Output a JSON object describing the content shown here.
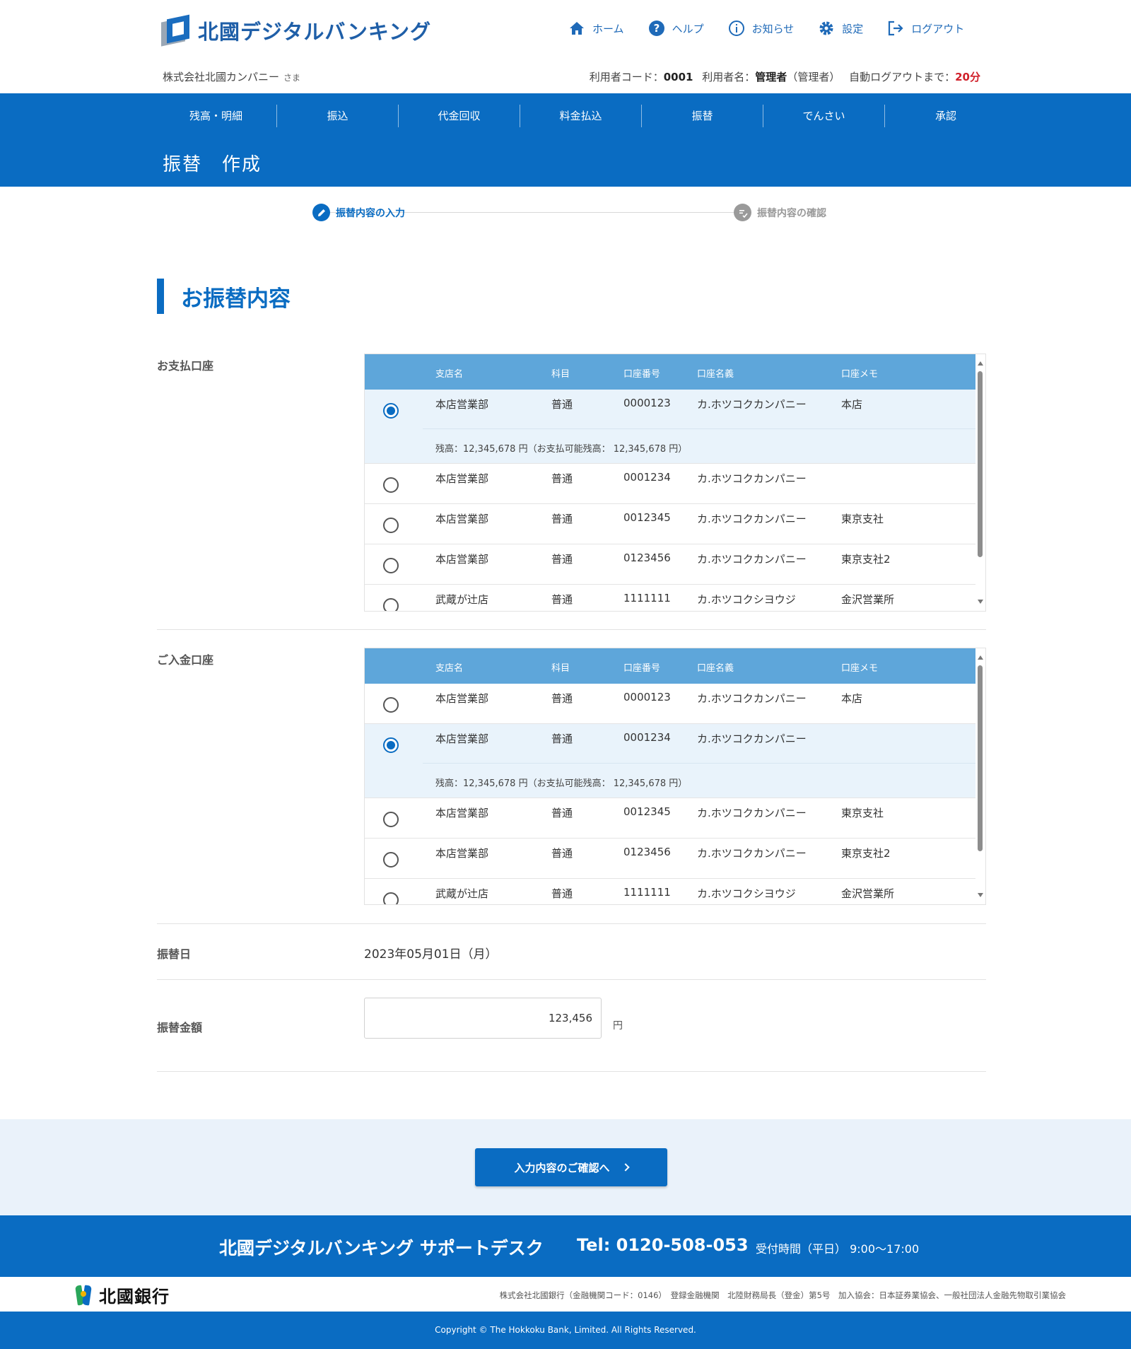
{
  "header": {
    "brand": "北國デジタルバンキング",
    "nav": [
      {
        "label": "ホーム",
        "icon": "home-icon"
      },
      {
        "label": "ヘルプ",
        "icon": "help-icon"
      },
      {
        "label": "お知らせ",
        "icon": "info-icon"
      },
      {
        "label": "設定",
        "icon": "gear-icon"
      },
      {
        "label": "ログアウト",
        "icon": "logout-icon"
      }
    ],
    "company": "株式会社北國カンパニー",
    "honorific": "さま",
    "user_code_label": "利用者コード：",
    "user_code": "0001",
    "user_name_label": "利用者名：",
    "user_name": "管理者",
    "user_role": "（管理者）",
    "auto_logout_label": "自動ログアウトまで：",
    "auto_logout": "20分"
  },
  "global_nav": [
    "残高・明細",
    "振込",
    "代金回収",
    "料金払込",
    "振替",
    "でんさい",
    "承認"
  ],
  "page_title": "振替　作成",
  "stepper": {
    "step1": "振替内容の入力",
    "step2": "振替内容の確認"
  },
  "section_title": "お振替内容",
  "columns": [
    "支店名",
    "科目",
    "口座番号",
    "口座名義",
    "口座メモ"
  ],
  "payment": {
    "label": "お支払口座",
    "rows": [
      {
        "branch": "本店営業部",
        "type": "普通",
        "number": "0000123",
        "holder": "カ.ホツコクカンパニー",
        "memo": "本店",
        "selected": true,
        "balance": "残高：12,345,678 円（お支払可能残高： 12,345,678 円）"
      },
      {
        "branch": "本店営業部",
        "type": "普通",
        "number": "0001234",
        "holder": "カ.ホツコクカンパニー",
        "memo": ""
      },
      {
        "branch": "本店営業部",
        "type": "普通",
        "number": "0012345",
        "holder": "カ.ホツコクカンパニー",
        "memo": "東京支社"
      },
      {
        "branch": "本店営業部",
        "type": "普通",
        "number": "0123456",
        "holder": "カ.ホツコクカンパニー",
        "memo": "東京支社2"
      },
      {
        "branch": "武蔵が辻店",
        "type": "普通",
        "number": "1111111",
        "holder": "カ.ホツコクシヨウジ",
        "memo": "金沢営業所"
      }
    ]
  },
  "deposit": {
    "label": "ご入金口座",
    "rows": [
      {
        "branch": "本店営業部",
        "type": "普通",
        "number": "0000123",
        "holder": "カ.ホツコクカンパニー",
        "memo": "本店"
      },
      {
        "branch": "本店営業部",
        "type": "普通",
        "number": "0001234",
        "holder": "カ.ホツコクカンパニー",
        "memo": "",
        "selected": true,
        "balance": "残高：12,345,678 円（お支払可能残高： 12,345,678 円）"
      },
      {
        "branch": "本店営業部",
        "type": "普通",
        "number": "0012345",
        "holder": "カ.ホツコクカンパニー",
        "memo": "東京支社"
      },
      {
        "branch": "本店営業部",
        "type": "普通",
        "number": "0123456",
        "holder": "カ.ホツコクカンパニー",
        "memo": "東京支社2"
      },
      {
        "branch": "武蔵が辻店",
        "type": "普通",
        "number": "1111111",
        "holder": "カ.ホツコクシヨウジ",
        "memo": "金沢営業所"
      }
    ]
  },
  "transfer_date": {
    "label": "振替日",
    "value": "2023年05月01日（月）"
  },
  "amount": {
    "label": "振替金額",
    "value": "123,456",
    "unit": "円"
  },
  "confirm_button": "入力内容のご確認へ",
  "support": {
    "desk": "北國デジタルバンキング サポートデスク",
    "tel": "Tel: 0120-508-053",
    "hours": "受付時間（平日） 9:00〜17:00"
  },
  "footer": {
    "bank_name": "北國銀行",
    "legal": "株式会社北國銀行（金融機関コード：0146）　登録金融機関　北陸財務局長（登金）第5号　加入協会：日本証券業協会、一般社団法人金融先物取引業協会",
    "copyright": "Copyright © The Hokkoku Bank, Limited. All Rights Reserved."
  },
  "colors": {
    "primary": "#0a6cc2",
    "table_header": "#5ea6da",
    "selected_row": "#e9f3fb",
    "alert": "#d0202a"
  }
}
